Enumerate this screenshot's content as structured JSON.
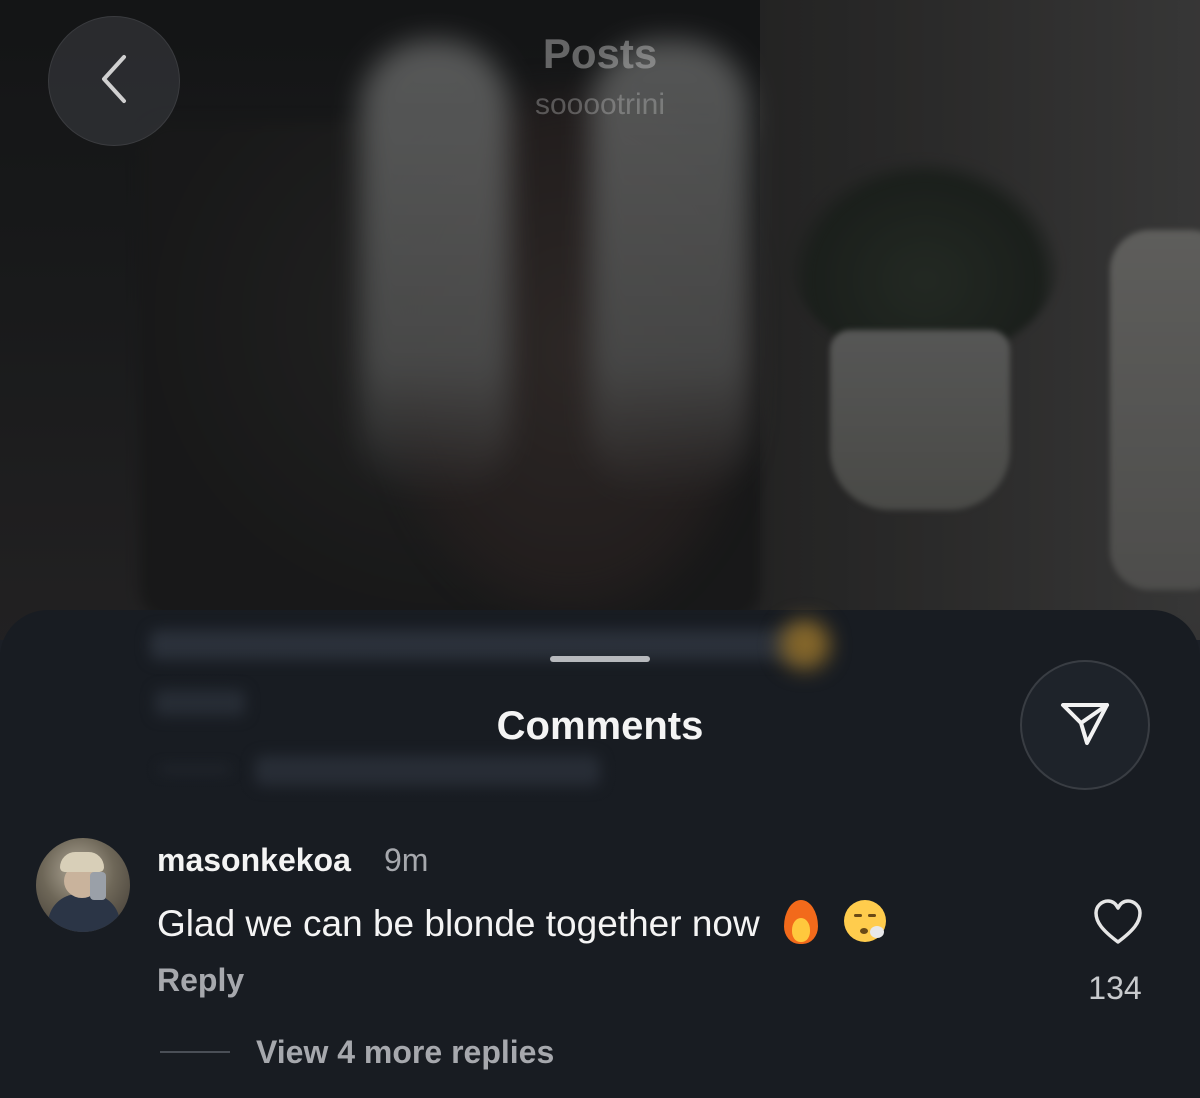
{
  "header": {
    "title": "Posts",
    "subtitle": "sooootrini"
  },
  "sheet": {
    "title": "Comments"
  },
  "comment": {
    "username": "masonkekoa",
    "time": "9m",
    "text": "Glad we can be blonde together now",
    "emojis": [
      "fire-emoji",
      "face-exhaling-emoji"
    ],
    "reply_label": "Reply",
    "like_count": "134",
    "view_replies_label": "View 4 more replies"
  },
  "icons": {
    "back": "chevron-left-icon",
    "share": "paper-plane-icon",
    "like": "heart-outline-icon"
  },
  "colors": {
    "sheet_background": "#181c22",
    "primary_text": "#f4f4f4",
    "secondary_text": "#a6a8ad"
  }
}
